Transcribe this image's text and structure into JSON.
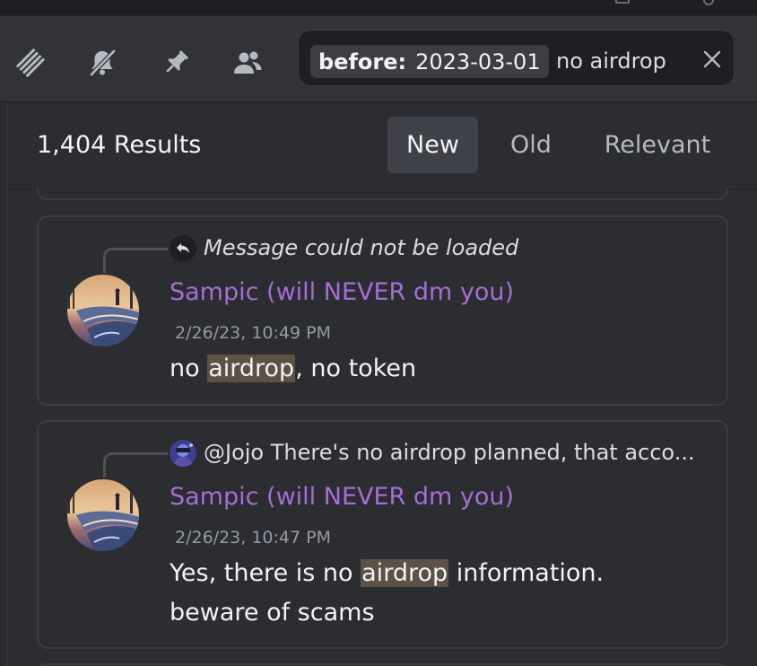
{
  "toolbar": {
    "icons": [
      "threads-icon",
      "mute-bell-icon",
      "pin-icon",
      "members-icon"
    ],
    "search": {
      "filter_key": "before:",
      "filter_value": "2023-03-01",
      "query": "no airdrop"
    }
  },
  "results": {
    "count_label": "1,404 Results",
    "sort_tabs": [
      {
        "label": "New",
        "active": true
      },
      {
        "label": "Old",
        "active": false
      },
      {
        "label": "Relevant",
        "active": false
      }
    ]
  },
  "messages": [
    {
      "reply_text": "Message could not be loaded",
      "author": "Sampic (will NEVER dm you)",
      "timestamp": "2/26/23, 10:49 PM",
      "lines": [
        {
          "before": "no ",
          "highlight": "airdrop",
          "after": ", no token"
        }
      ]
    },
    {
      "reply_text": "@Jojo There's no airdrop planned, that acco...",
      "author": "Sampic (will NEVER dm you)",
      "timestamp": "2/26/23, 10:47 PM",
      "lines": [
        {
          "before": "Yes, there is no ",
          "highlight": "airdrop",
          "after": " information."
        },
        {
          "before": "beware of scams",
          "highlight": "",
          "after": ""
        }
      ]
    }
  ],
  "colors": {
    "accent_username": "#a56ed6",
    "highlight_bg": "#5b5144",
    "panel_bg": "#2b2d31",
    "toolbar_bg": "#313338"
  }
}
